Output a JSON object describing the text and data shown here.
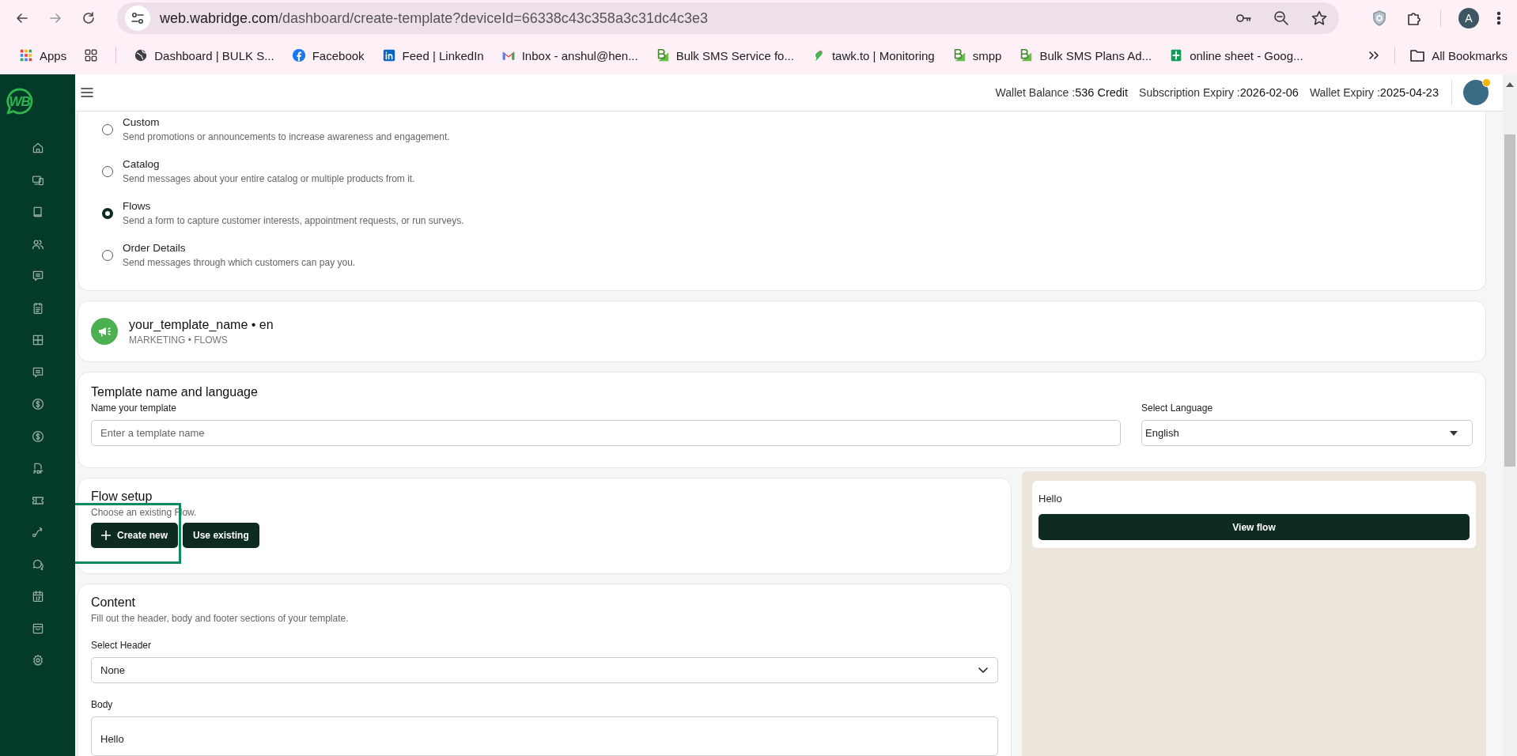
{
  "browser": {
    "url_host": "web.wabridge.com",
    "url_path": "/dashboard/create-template?deviceId=66338c43c358a3c31dc4c3e3",
    "profile_initial": "A",
    "bookmarks": [
      {
        "label": "Apps",
        "kind": "apps"
      },
      {
        "label": "Dashboard | BULK S...",
        "kind": "globe"
      },
      {
        "label": "Facebook",
        "kind": "facebook"
      },
      {
        "label": "Feed | LinkedIn",
        "kind": "linkedin"
      },
      {
        "label": "Inbox - anshul@hen...",
        "kind": "mail"
      },
      {
        "label": "Bulk SMS Service fo...",
        "kind": "b"
      },
      {
        "label": "tawk.to | Monitoring",
        "kind": "bird"
      },
      {
        "label": "smpp",
        "kind": "b"
      },
      {
        "label": "Bulk SMS Plans Ad...",
        "kind": "b"
      },
      {
        "label": "online sheet - Goog...",
        "kind": "sheet"
      }
    ],
    "all_bookmarks": "All Bookmarks"
  },
  "sidebar": {
    "logo": "WB"
  },
  "header": {
    "stats": [
      {
        "label": "Wallet Balance :",
        "value": "536 Credit"
      },
      {
        "label": "Subscription Expiry :",
        "value": "2026-02-06"
      },
      {
        "label": "Wallet Expiry :",
        "value": "2025-04-23"
      }
    ]
  },
  "message_types": [
    {
      "title": "Custom",
      "description": "Send promotions or announcements to increase awareness and engagement.",
      "selected": false
    },
    {
      "title": "Catalog",
      "description": "Send messages about your entire catalog or multiple products from it.",
      "selected": false
    },
    {
      "title": "Flows",
      "description": "Send a form to capture customer interests, appointment requests, or run surveys.",
      "selected": true
    },
    {
      "title": "Order Details",
      "description": "Send messages through which customers can pay you.",
      "selected": false
    }
  ],
  "template_summary": {
    "title": "your_template_name • en",
    "subtitle": "MARKETING • FLOWS"
  },
  "template_name": {
    "heading": "Template name and language",
    "name_label": "Name your template",
    "name_placeholder": "Enter a template name",
    "language_label": "Select Language",
    "language_value": "English"
  },
  "flow_setup": {
    "heading": "Flow setup",
    "hint": "Choose an existing Flow.",
    "buttons": [
      {
        "label": "Create new",
        "kind": "plus"
      },
      {
        "label": "Use existing",
        "kind": "plain"
      }
    ],
    "highlighted": true
  },
  "content": {
    "heading": "Content",
    "description": "Fill out the header, body and footer sections of your template.",
    "header_label": "Select Header",
    "header_value": "None",
    "body_label": "Body",
    "body_value": "Hello"
  },
  "preview": {
    "message": "Hello",
    "button": "View flow"
  }
}
